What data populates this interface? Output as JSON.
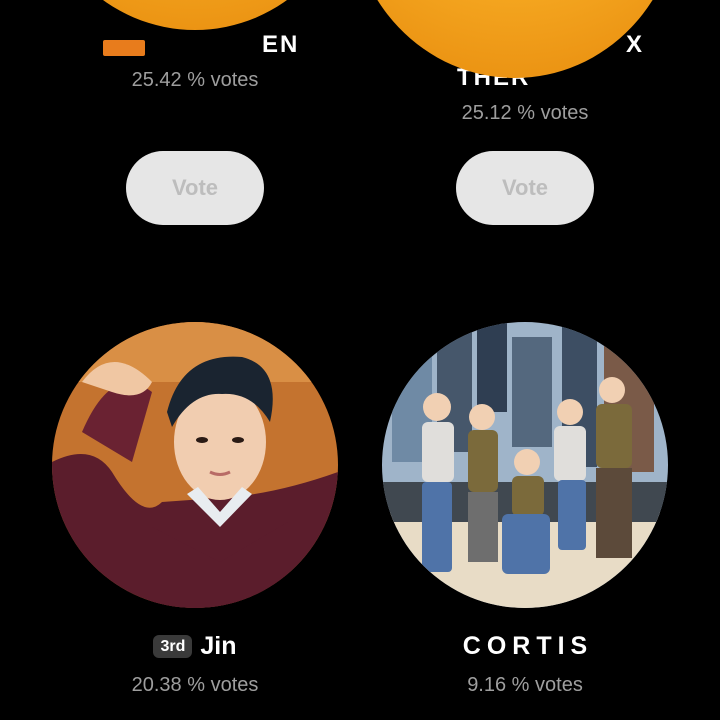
{
  "top_row": {
    "left": {
      "name_partial": "EN",
      "votes": "25.42 % votes",
      "vote_label": "Vote"
    },
    "right": {
      "name_line1_partial": "X",
      "name_line2_partial": "THER",
      "votes": "25.12 % votes",
      "vote_label": "Vote"
    }
  },
  "bottom_row": {
    "left": {
      "rank": "3rd",
      "name": "Jin",
      "votes": "20.38 % votes"
    },
    "right": {
      "name": "CORTIS",
      "votes": "9.16 % votes"
    }
  },
  "colors": {
    "background": "#000000",
    "emoji_yellow": "#f4a51f",
    "vote_button_bg": "#e6e6e6",
    "vote_button_text": "#bdbdbd",
    "votes_text": "#9e9e9e",
    "rank_badge_bg": "#3a3a3a"
  }
}
